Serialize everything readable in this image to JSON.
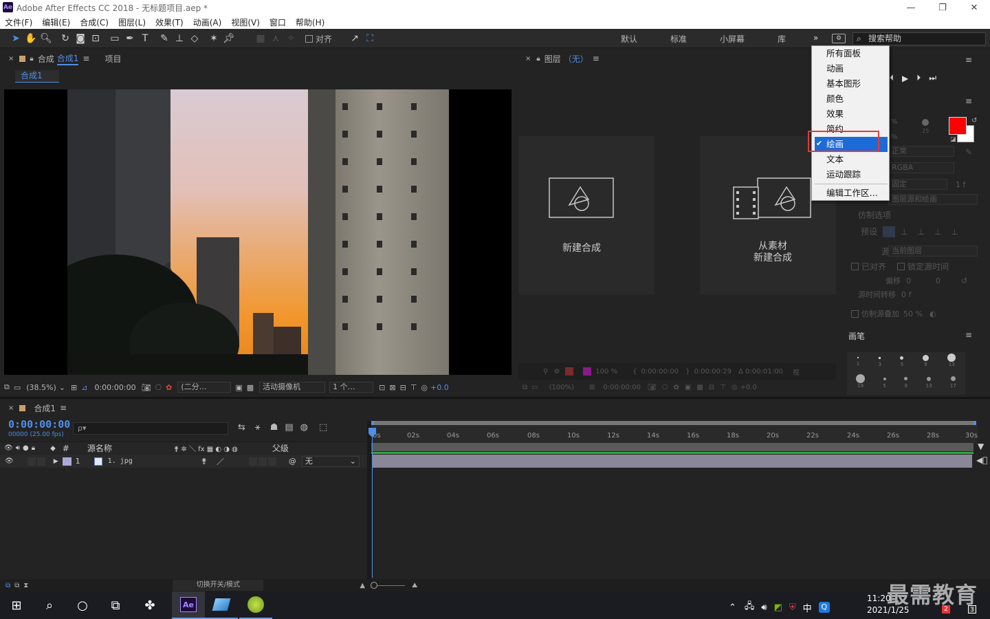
{
  "window": {
    "title": "Adobe After Effects CC 2018 - 无标题项目.aep *",
    "logo": "Ae",
    "min": "—",
    "max": "❐",
    "close": "✕"
  },
  "menu": [
    "文件(F)",
    "编辑(E)",
    "合成(C)",
    "图层(L)",
    "效果(T)",
    "动画(A)",
    "视图(V)",
    "窗口",
    "帮助(H)"
  ],
  "toolbar": {
    "align_label": "对齐",
    "workspaces": [
      "默认",
      "标准",
      "小屏幕",
      "库"
    ],
    "more": "»",
    "search_placeholder": "搜索帮助"
  },
  "comp_panel": {
    "tab_prefix": "合成",
    "tab_name": "合成1",
    "menu_glyph": "≡",
    "project_tab": "项目",
    "subtab": "合成1",
    "zoom": "(38.5%)",
    "time": "0:00:00:00",
    "resolution": "(二分…",
    "camera": "活动摄像机",
    "views": "1 个…",
    "offset": "+0.0"
  },
  "layer_panel": {
    "tab_label": "图层",
    "tab_value": "（无）",
    "new_comp": "新建合成",
    "from_footage_line1": "从素材",
    "from_footage_line2": "新建合成",
    "zoom": "(100%)",
    "opacity": "100 %",
    "t1": "0:00:00:00",
    "t2": "0:00:00:29",
    "t3": "Δ 0:00:01:00",
    "view": "视",
    "t4": "0:00:00:00",
    "offset": "+0.0"
  },
  "ws_menu": {
    "items": [
      "所有面板",
      "动画",
      "基本图形",
      "颜色",
      "效果",
      "简约",
      "绘画",
      "文本",
      "运动跟踪",
      "编辑工作区…"
    ],
    "checked_index": 6
  },
  "right_panel": {
    "pct1": "%",
    "pct2": "%",
    "num25": "25",
    "mode": "正常",
    "channel": "RGBA",
    "duration": "固定",
    "duration_val": "1 f",
    "target": "图层源和绘画",
    "clone_options": "仿制选项",
    "preset": "预设",
    "source": "源",
    "source_val": "当前图层",
    "aligned": "已对齐",
    "lock_time": "锁定源时间",
    "offset": "偏移",
    "offset_x": "0",
    "offset_y": "0",
    "time_shift": "源时间转移",
    "time_shift_val": "0 f",
    "overlay": "仿制源叠加",
    "overlay_val": "50 %",
    "brush_title": "画笔",
    "brush_sizes_row1": [
      "1",
      "3",
      "5",
      "9",
      "13"
    ],
    "brush_sizes_row2": [
      "19",
      "5",
      "9",
      "13",
      "17"
    ]
  },
  "timeline": {
    "tab": "合成1",
    "timecode": "0:00:00:00",
    "frames": "00000 (25.00 fps)",
    "search_placeholder": "ρ▾",
    "col_hash": "#",
    "col_source": "源名称",
    "col_parent": "父级",
    "layer_num": "1",
    "layer_name": "1. jpg",
    "parent_val": "无",
    "bottom_label": "切换开关/模式",
    "ticks": [
      "0s",
      "02s",
      "04s",
      "06s",
      "08s",
      "10s",
      "12s",
      "14s",
      "16s",
      "18s",
      "20s",
      "22s",
      "24s",
      "26s",
      "28s",
      "30s"
    ]
  },
  "taskbar": {
    "time": "11:20",
    "date": "2021/1/25",
    "ime": "中",
    "watermark": "最需教育",
    "badge1": "2",
    "badge2": "3"
  },
  "colors": {
    "accent": "#4f8fe9",
    "fg_color": "#ff0000",
    "bg_color": "#ffffff",
    "highlight": "#e23b3b",
    "layer_bar": "#8a8799",
    "layer_label": "#a9a9d6"
  }
}
